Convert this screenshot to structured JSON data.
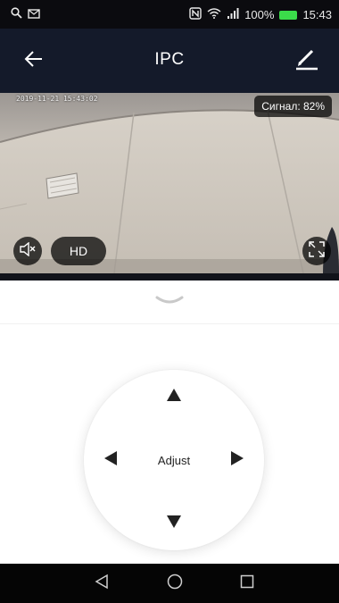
{
  "status_bar": {
    "battery": "100%",
    "time": "15:43",
    "left_icons": [
      "search-icon",
      "mail-icon"
    ],
    "right_icons": [
      "nfc-icon",
      "wifi-icon",
      "signal-bars-icon",
      "battery-icon"
    ],
    "battery_color": "#3bdc4a"
  },
  "app_bar": {
    "title": "IPC",
    "back_icon": "arrow-left-icon",
    "edit_icon": "pencil-icon",
    "background": "#141a2a"
  },
  "camera": {
    "timestamp": "2019-11-21 15:43:02",
    "signal": "Сигнал: 82%",
    "quality_label": "HD",
    "mute_icon": "speaker-muted-icon",
    "fullscreen_icon": "fullscreen-icon"
  },
  "ptz": {
    "label": "Adjust",
    "directions": [
      "up",
      "down",
      "left",
      "right"
    ]
  },
  "nav_bar": {
    "icons": [
      "nav-back-icon",
      "nav-home-icon",
      "nav-recent-icon"
    ]
  }
}
